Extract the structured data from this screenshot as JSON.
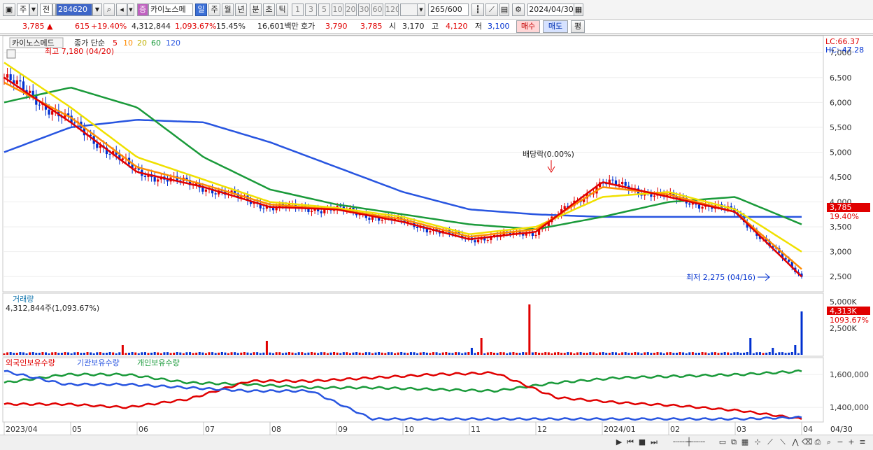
{
  "toolbar": {
    "market": "주",
    "type": "전",
    "code": "284620",
    "sector_badge": "증",
    "name": "카이노스메",
    "periods": [
      "일",
      "주",
      "월",
      "년",
      "분",
      "초",
      "틱"
    ],
    "active_period": "일",
    "intervals": [
      "1",
      "3",
      "5",
      "10",
      "20",
      "30",
      "60",
      "120"
    ],
    "count": "265",
    "count_total": "/600",
    "date": "2024/04/30"
  },
  "quote": {
    "price": "3,785",
    "arrow": "▲",
    "change": "615",
    "change_pct": "+19.40%",
    "volume": "4,312,844",
    "volume_pct": "1,093.67%",
    "turnover": "15.45%",
    "amount": "16,601백만",
    "ask_label": "호가",
    "ask": "3,790",
    "bid": "3,785",
    "open_label": "시",
    "open": "3,170",
    "high_label": "고",
    "high": "4,120",
    "low_label": "저",
    "low": "3,100",
    "buy": "매수",
    "sell": "매도",
    "eval": "평"
  },
  "legend": {
    "name": "카이노스메드",
    "ma_label": "종가 단순",
    "ma_periods": [
      "5",
      "10",
      "20",
      "60",
      "120"
    ]
  },
  "annotations": {
    "high": "최고 7,180 (04/20)",
    "low": "최저 2,275 (04/16)",
    "dividend": "배당락(0.00%)"
  },
  "right_labels": {
    "lc": "LC:66.37",
    "hc": "HC:-47.28",
    "price_ticks": [
      "7,000",
      "6,500",
      "6,000",
      "5,500",
      "5,000",
      "4,500",
      "4,000",
      "3,500",
      "3,000",
      "2,500"
    ],
    "price_tag": "3,785",
    "pct_tag": "19.40%",
    "volume_ticks": [
      "5,000K",
      "2,500K"
    ],
    "volume_tag": "4,313K",
    "volume_pct_tag": "1093.67%",
    "holding_ticks": [
      "1,600,000",
      "1,400,000"
    ]
  },
  "volume_panel": {
    "title": "거래량",
    "value": "4,312,844주(1,093.67%)"
  },
  "holding_panel": {
    "foreign": "외국인보유수량",
    "inst": "기관보유수량",
    "indiv": "개인보유수량"
  },
  "x_axis": [
    "2023/04",
    "05",
    "06",
    "07",
    "08",
    "09",
    "10",
    "11",
    "12",
    "2024/01",
    "02",
    "03",
    "04"
  ],
  "x_axis_end": "04/30",
  "colors": {
    "up": "#e00000",
    "down": "#0030d0",
    "ma5": "#e00000",
    "ma10": "#ff8c00",
    "ma20": "#f0e000",
    "ma60": "#1a9a3a",
    "ma120": "#2855e0"
  },
  "chart_data": {
    "type": "line",
    "x": [
      "2023/04",
      "05",
      "06",
      "07",
      "08",
      "09",
      "10",
      "11",
      "12",
      "2024/01",
      "02",
      "03",
      "04"
    ],
    "series": [
      {
        "name": "5",
        "values": [
          6500,
          5600,
          4600,
          4300,
          3900,
          3850,
          3600,
          3250,
          3400,
          4400,
          4100,
          3800,
          2500
        ]
      },
      {
        "name": "10",
        "values": [
          6400,
          5700,
          4700,
          4350,
          3950,
          3850,
          3650,
          3300,
          3450,
          4300,
          4150,
          3800,
          2650
        ]
      },
      {
        "name": "20",
        "values": [
          6800,
          5900,
          4900,
          4450,
          4000,
          3880,
          3700,
          3350,
          3500,
          4100,
          4200,
          3850,
          3000
        ]
      },
      {
        "name": "60",
        "values": [
          6000,
          6300,
          5900,
          4900,
          4250,
          3950,
          3750,
          3550,
          3450,
          3700,
          4000,
          4100,
          3550
        ]
      },
      {
        "name": "120",
        "values": [
          5000,
          5500,
          5650,
          5600,
          5200,
          4700,
          4200,
          3850,
          3750,
          3700,
          3700,
          3700,
          3700
        ]
      }
    ],
    "ylim": [
      2250,
      7200
    ]
  }
}
